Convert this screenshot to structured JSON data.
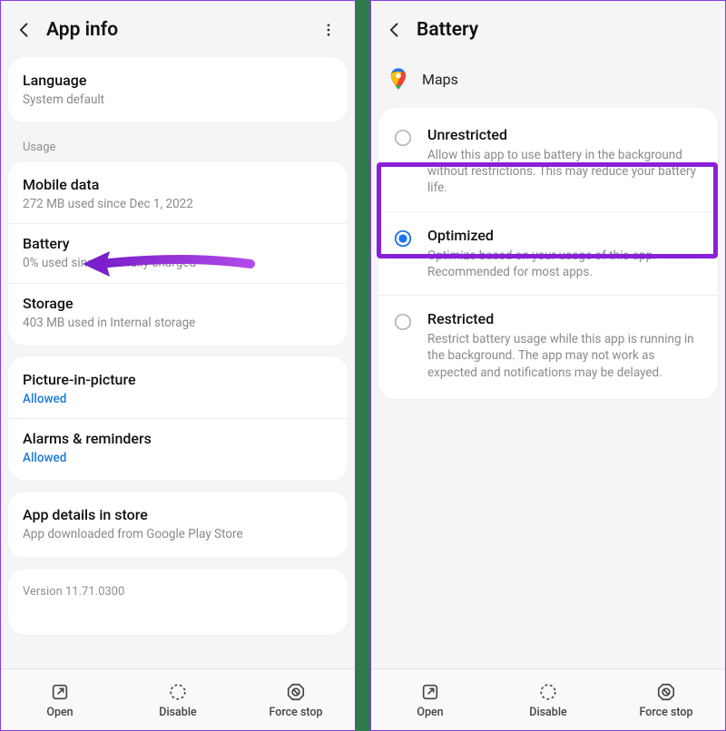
{
  "left": {
    "title": "App info",
    "language": {
      "label": "Language",
      "sub": "System default"
    },
    "usage_header": "Usage",
    "mobile_data": {
      "label": "Mobile data",
      "sub": "272 MB used since Dec 1, 2022"
    },
    "battery": {
      "label": "Battery",
      "sub": "0% used since last fully charged"
    },
    "storage": {
      "label": "Storage",
      "sub": "403 MB used in Internal storage"
    },
    "pip": {
      "label": "Picture-in-picture",
      "sub": "Allowed"
    },
    "alarms": {
      "label": "Alarms & reminders",
      "sub": "Allowed"
    },
    "store": {
      "label": "App details in store",
      "sub": "App downloaded from Google Play Store"
    },
    "version": "Version 11.71.0300"
  },
  "right": {
    "title": "Battery",
    "app_name": "Maps",
    "unrestricted": {
      "label": "Unrestricted",
      "sub": "Allow this app to use battery in the background without restrictions. This may reduce your battery life."
    },
    "optimized": {
      "label": "Optimized",
      "sub": "Optimize based on your usage of this app. Recommended for most apps."
    },
    "restricted": {
      "label": "Restricted",
      "sub": "Restrict battery usage while this app is running in the background. The app may not work as expected and notifications may be delayed."
    }
  },
  "bottombar": {
    "open": "Open",
    "disable": "Disable",
    "force_stop": "Force stop"
  }
}
